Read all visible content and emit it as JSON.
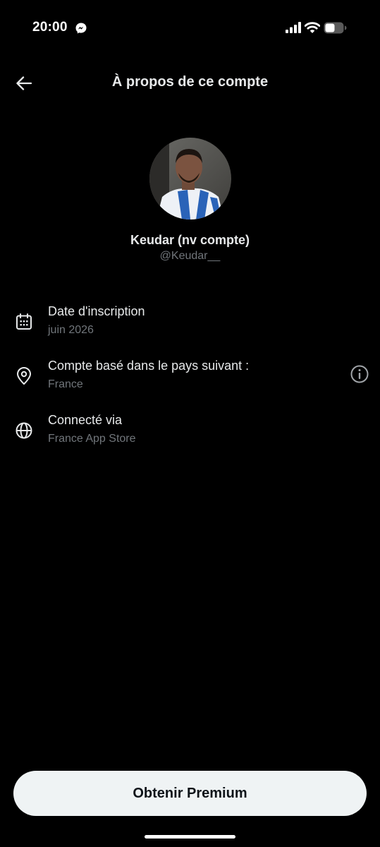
{
  "status_bar": {
    "time": "20:00",
    "icons": [
      "messenger-icon",
      "signal-icon",
      "wifi-icon",
      "battery-icon"
    ]
  },
  "header": {
    "title": "À propos de ce compte",
    "back_icon": "arrow-left-icon"
  },
  "profile": {
    "name": "Keudar (nv compte)",
    "handle": "@Keudar__"
  },
  "info": [
    {
      "icon": "calendar-icon",
      "label": "Date d'inscription",
      "value": "juin 2026"
    },
    {
      "icon": "location-pin-icon",
      "label": "Compte basé dans le pays suivant :",
      "value": "France",
      "action_icon": "info-circle-icon"
    },
    {
      "icon": "globe-icon",
      "label": "Connecté via",
      "value": "France App Store"
    }
  ],
  "cta": {
    "label": "Obtenir Premium"
  },
  "colors": {
    "background": "#000000",
    "primary_text": "#e7e9ea",
    "secondary_text": "#71767b",
    "button_background": "#eff3f4",
    "button_text": "#0f1419"
  }
}
